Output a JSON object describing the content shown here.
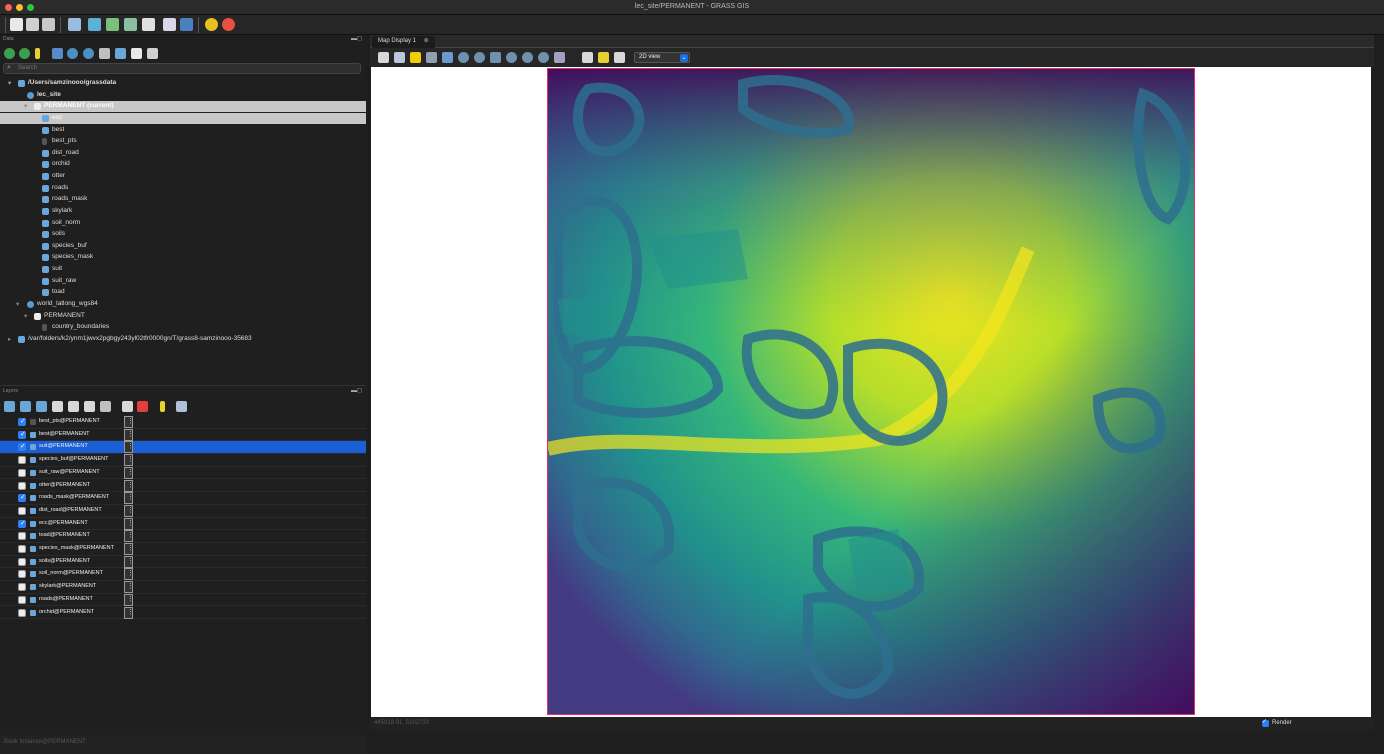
{
  "window": {
    "title": "lec_site/PERMANENT - GRASS GIS"
  },
  "data_panel": {
    "label": "Data",
    "search_placeholder": "Search",
    "tree": [
      {
        "label": "/Users/samzinooo/grassdata",
        "icon": "database-icon"
      },
      {
        "label": "lec_site",
        "icon": "globe-icon"
      },
      {
        "label": "PERMANENT  (current)",
        "icon": "folder-icon"
      },
      {
        "label": "ecc",
        "icon": "raster-icon"
      },
      {
        "label": "best",
        "icon": "raster-icon"
      },
      {
        "label": "best_pts",
        "icon": "vector-icon"
      },
      {
        "label": "dist_road",
        "icon": "raster-icon"
      },
      {
        "label": "orchid",
        "icon": "raster-icon"
      },
      {
        "label": "otter",
        "icon": "raster-icon"
      },
      {
        "label": "roads",
        "icon": "raster-icon"
      },
      {
        "label": "roads_mask",
        "icon": "raster-icon"
      },
      {
        "label": "skylark",
        "icon": "raster-icon"
      },
      {
        "label": "soil_norm",
        "icon": "raster-icon"
      },
      {
        "label": "soils",
        "icon": "raster-icon"
      },
      {
        "label": "species_buf",
        "icon": "raster-icon"
      },
      {
        "label": "species_mask",
        "icon": "raster-icon"
      },
      {
        "label": "suit",
        "icon": "raster-icon"
      },
      {
        "label": "suit_raw",
        "icon": "raster-icon"
      },
      {
        "label": "toad",
        "icon": "raster-icon"
      },
      {
        "label": "world_latlong_wgs84",
        "icon": "globe-icon"
      },
      {
        "label": "PERMANENT",
        "icon": "folder-icon"
      },
      {
        "label": "country_boundaries",
        "icon": "vector-icon"
      },
      {
        "label": "/var/folders/k2/ynm1jwvx2pgbgy243yl02tfr0000gn/T/grass8-samzinooo-35683",
        "icon": "database-icon"
      }
    ]
  },
  "layers_panel": {
    "label": "Layers",
    "layers": [
      {
        "name": "best_pts@PERMANENT",
        "checked": true
      },
      {
        "name": "best@PERMANENT",
        "checked": true
      },
      {
        "name": "suit@PERMANENT",
        "checked": true
      },
      {
        "name": "species_buf@PERMANENT",
        "checked": false
      },
      {
        "name": "suit_raw@PERMANENT",
        "checked": false
      },
      {
        "name": "otter@PERMANENT",
        "checked": false
      },
      {
        "name": "roads_mask@PERMANENT",
        "checked": true
      },
      {
        "name": "dist_road@PERMANENT",
        "checked": false
      },
      {
        "name": "ecc@PERMANENT",
        "checked": true
      },
      {
        "name": "toad@PERMANENT",
        "checked": false
      },
      {
        "name": "species_mask@PERMANENT",
        "checked": false
      },
      {
        "name": "soils@PERMANENT",
        "checked": false
      },
      {
        "name": "soil_norm@PERMANENT",
        "checked": false
      },
      {
        "name": "skylark@PERMANENT",
        "checked": false
      },
      {
        "name": "roads@PERMANENT",
        "checked": false
      },
      {
        "name": "orchid@PERMANENT",
        "checked": false
      }
    ]
  },
  "statusbar": {
    "text": "Book Instance@PERMANENT"
  },
  "map_display": {
    "tab_label": "Map Display 1",
    "view_mode": "2D view",
    "coords": "445918.91, 5102733",
    "render_label": "Render",
    "render_checked": true
  },
  "colors": {
    "selection": "#1a5fd6",
    "raster_border": "#e0306a",
    "viridis_dark": "#440154",
    "viridis_mid": "#21918c",
    "viridis_bright": "#fde725"
  }
}
